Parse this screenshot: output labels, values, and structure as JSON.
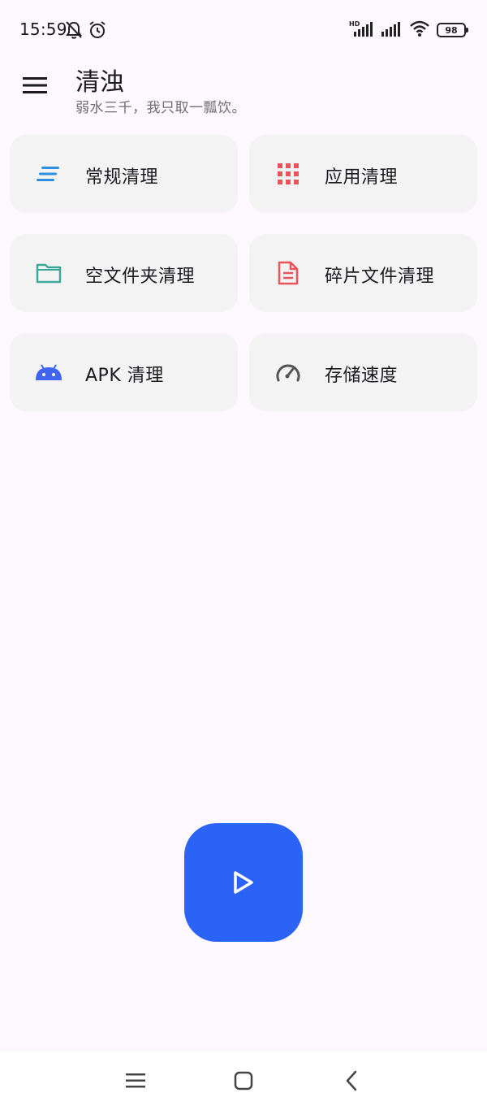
{
  "status_bar": {
    "time": "15:59",
    "battery_level": "98",
    "icons": [
      "bell-off-icon",
      "alarm-icon",
      "hd-signal-icon",
      "signal-icon",
      "wifi-icon",
      "battery-icon"
    ]
  },
  "app_bar": {
    "title": "清浊",
    "subtitle": "弱水三千，我只取一瓢饮。",
    "menu_icon": "hamburger-menu-icon"
  },
  "tiles": [
    {
      "label": "常规清理",
      "icon": "lines-icon",
      "icon_color": "#2f8fe0"
    },
    {
      "label": "应用清理",
      "icon": "grid-icon",
      "icon_color": "#e8545a"
    },
    {
      "label": "空文件夹清理",
      "icon": "folder-icon",
      "icon_color": "#3ea898"
    },
    {
      "label": "碎片文件清理",
      "icon": "document-icon",
      "icon_color": "#e8545a"
    },
    {
      "label": "APK 清理",
      "icon": "android-icon",
      "icon_color": "#3f64f0"
    },
    {
      "label": "存储速度",
      "icon": "speedometer-icon",
      "icon_color": "#555555"
    }
  ],
  "fab": {
    "icon": "play-icon",
    "color": "#2b63f7"
  },
  "nav_bar": {
    "buttons": [
      "recents-icon",
      "home-icon",
      "back-icon"
    ]
  }
}
